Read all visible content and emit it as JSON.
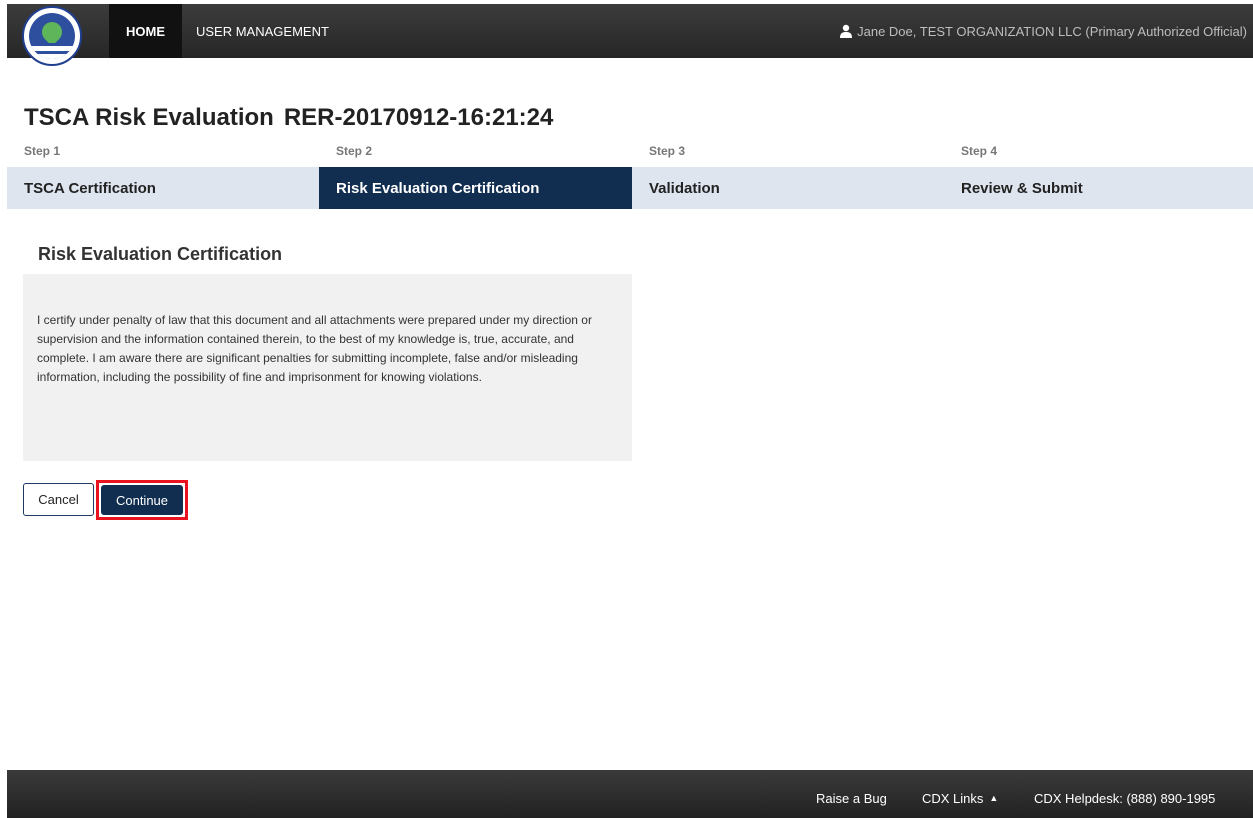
{
  "header": {
    "nav": {
      "home": "HOME",
      "user_management": "USER MANAGEMENT"
    },
    "user": "Jane Doe, TEST ORGANIZATION LLC (Primary Authorized Official)"
  },
  "page": {
    "title": "TSCA Risk Evaluation",
    "record_id": "RER-20170912-16:21:24"
  },
  "steps": [
    {
      "label": "Step 1",
      "name": "TSCA Certification",
      "active": false
    },
    {
      "label": "Step 2",
      "name": "Risk Evaluation Certification",
      "active": true
    },
    {
      "label": "Step 3",
      "name": "Validation",
      "active": false
    },
    {
      "label": "Step 4",
      "name": "Review & Submit",
      "active": false
    }
  ],
  "section": {
    "title": "Risk Evaluation Certification",
    "certification_text": "I certify under penalty of law that this document and all attachments were prepared under my direction or supervision and the information contained therein, to the best of my knowledge is, true, accurate, and complete. I am aware there are significant penalties for submitting incomplete, false and/or misleading information, including the possibility of fine and imprisonment for knowing violations."
  },
  "buttons": {
    "cancel": "Cancel",
    "continue": "Continue"
  },
  "footer": {
    "raise_bug": "Raise a Bug",
    "cdx_links": "CDX Links",
    "helpdesk": "CDX Helpdesk: (888) 890-1995"
  },
  "colors": {
    "header_bg": "#2b2b2b",
    "active_step": "#112e51",
    "inactive_step": "#dfe5ef",
    "highlight": "#e8131e"
  }
}
